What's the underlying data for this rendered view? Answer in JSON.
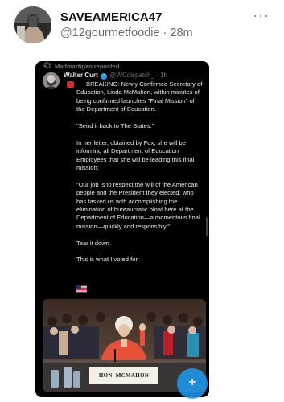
{
  "post": {
    "author_name": "SAVEAMERICA47",
    "author_meta": "@12gourmetfoodie · 28m",
    "more_label": "···"
  },
  "embed": {
    "reposted_by": "Madmartigan reposted",
    "tweet": {
      "name": "Walter Curt",
      "verified_mark": "✓",
      "handle": "@WCdispatch_ · 1h",
      "paragraphs": [
        "BREAKING: Newly Confirmed Secretary of Education, Linda McMahon, within minutes of being confirmed launches \"Final Mission\" of the Department of Education.",
        "\"Send it back to The States.\"",
        "In her letter, obtained by Fox, she will be informing all Department of Education Employees that she will be leading this final mission:",
        "\"Our job is to respect the will of the American people and the President they elected, who has tasked us with accomplishing the elimination of bureaucratic bloat here at the Department of Education—a momentous final mission—quickly and responsibly.\"",
        "Tear it down.",
        "This is what I voted for."
      ],
      "image_nameplate": "HON. MCMAHON"
    },
    "fab_label": "+"
  },
  "icons": {
    "repost": "repost-icon",
    "verified": "verified-badge-icon",
    "siren": "siren-emoji-icon",
    "flag": "us-flag-emoji-icon"
  },
  "colors": {
    "tweet_background": "#000000",
    "tweet_text": "#e7e9ea",
    "muted": "#71767b",
    "accent": "#1d9bf0",
    "jacket": "#e8503a"
  }
}
